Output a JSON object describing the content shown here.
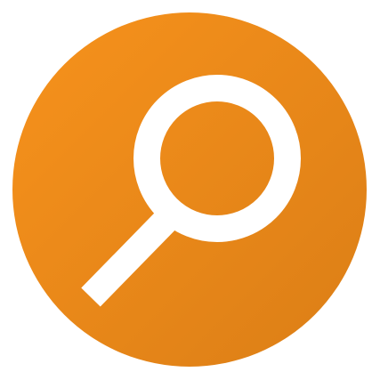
{
  "app_icon": {
    "name": "search-icon",
    "colors": {
      "circle_light": "#F7921C",
      "circle_dark": "#DB7E16",
      "glyph": "#FFFFFF",
      "background": "#FFFFFF"
    }
  }
}
